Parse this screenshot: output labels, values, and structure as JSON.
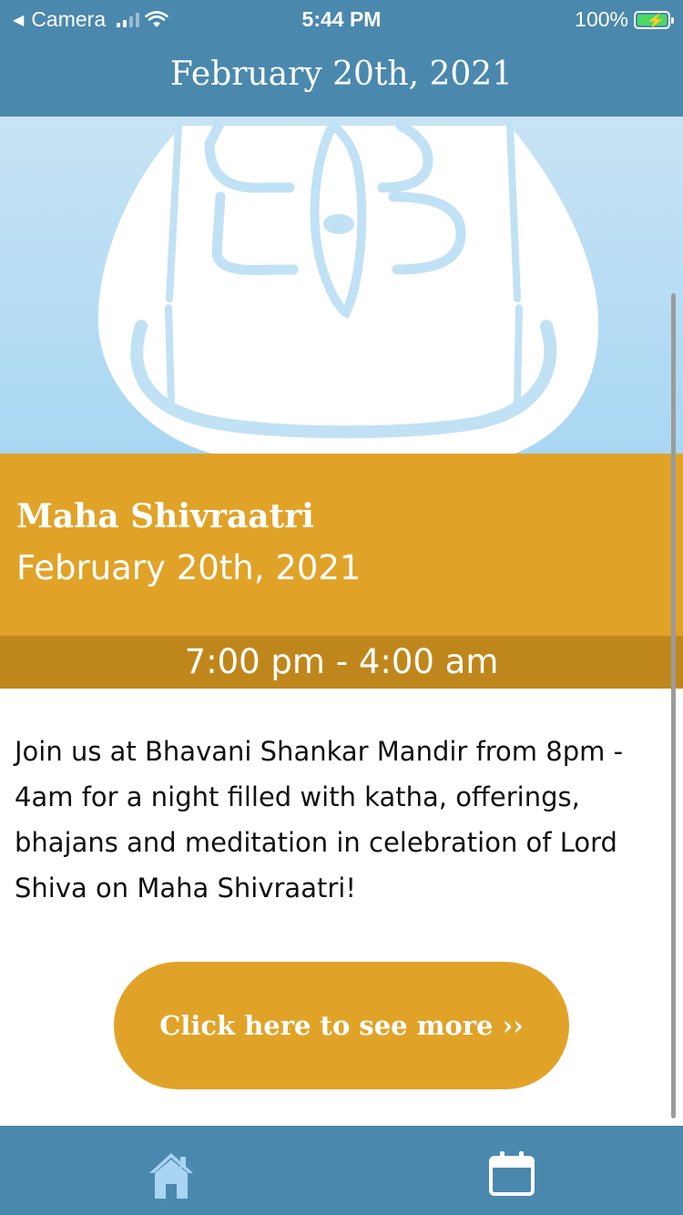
{
  "status_bar": {
    "back_app": "Camera",
    "time": "5:44 PM",
    "battery_percent": "100%",
    "signal_bars_filled": 2,
    "signal_bars_total": 4,
    "battery_level": 1.0,
    "charging": true,
    "icons": [
      "back-triangle-icon",
      "signal-icon",
      "wifi-icon",
      "battery-charging-icon"
    ]
  },
  "header": {
    "title": "February 20th, 2021"
  },
  "hero": {
    "image": "shiva-lingam-illustration"
  },
  "event": {
    "title": "Maha Shivraatri",
    "date": "February 20th, 2021",
    "time_range": "7:00 pm - 4:00 am",
    "description": "Join us at Bhavani Shankar Mandir from 8pm - 4am for a night filled with katha, offerings, bhajans and meditation in celebration of Lord Shiva on Maha Shivraatri!"
  },
  "more_button": {
    "label": "Click here to see more ››"
  },
  "tab_bar": {
    "items": [
      {
        "icon": "home-icon",
        "active": true
      },
      {
        "icon": "calendar-icon",
        "active": false
      }
    ]
  },
  "colors": {
    "header_blue": "#4a88ad",
    "accent_gold": "#e0a328",
    "time_bar_gold": "#bf871b",
    "hero_sky": "#b4dcf4",
    "active_tab": "#a9d4f3"
  }
}
